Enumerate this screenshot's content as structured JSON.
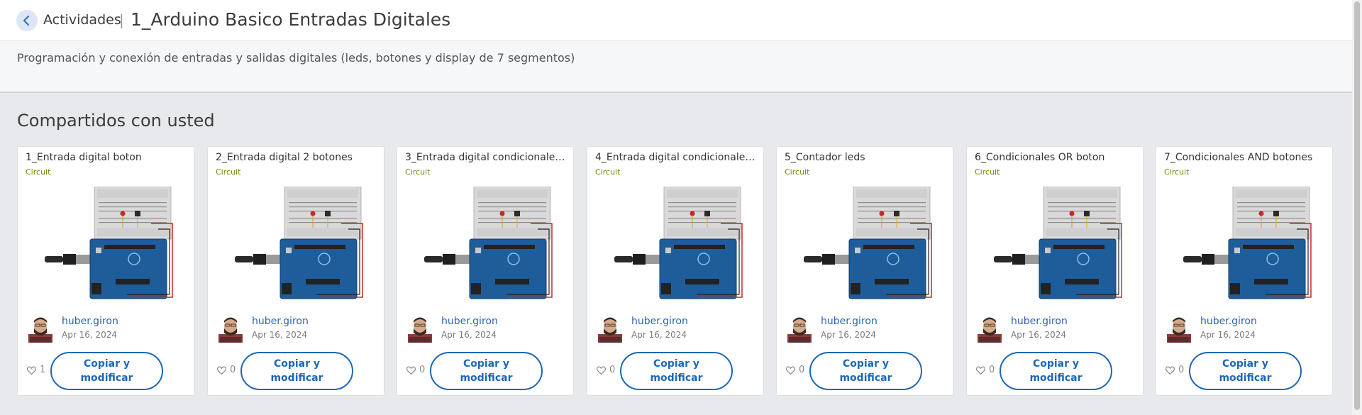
{
  "header": {
    "back_label": "Actividades",
    "separator": "|",
    "title": "1_Arduino Basico Entradas Digitales"
  },
  "description": "Programación y conexión de entradas y salidas digitales (leds, botones y display de 7 segmentos)",
  "section_title": "Compartidos con usted",
  "cards": [
    {
      "title": "1_Entrada digital boton",
      "type": "Circuit",
      "author": "huber.giron",
      "date": "Apr 16, 2024",
      "likes": "1",
      "button": "Copiar y\nmodificar"
    },
    {
      "title": "2_Entrada digital 2 botones",
      "type": "Circuit",
      "author": "huber.giron",
      "date": "Apr 16, 2024",
      "likes": "0",
      "button": "Copiar y\nmodificar"
    },
    {
      "title": "3_Entrada digital condicionales ...",
      "type": "Circuit",
      "author": "huber.giron",
      "date": "Apr 16, 2024",
      "likes": "0",
      "button": "Copiar y\nmodificar"
    },
    {
      "title": "4_Entrada digital condicionales ...",
      "type": "Circuit",
      "author": "huber.giron",
      "date": "Apr 16, 2024",
      "likes": "0",
      "button": "Copiar y\nmodificar"
    },
    {
      "title": "5_Contador leds",
      "type": "Circuit",
      "author": "huber.giron",
      "date": "Apr 16, 2024",
      "likes": "0",
      "button": "Copiar y\nmodificar"
    },
    {
      "title": "6_Condicionales OR boton",
      "type": "Circuit",
      "author": "huber.giron",
      "date": "Apr 16, 2024",
      "likes": "0",
      "button": "Copiar y\nmodificar"
    },
    {
      "title": "7_Condicionales AND botones",
      "type": "Circuit",
      "author": "huber.giron",
      "date": "Apr 16, 2024",
      "likes": "0",
      "button": "Copiar y\nmodificar"
    }
  ],
  "icons": {
    "back": "chevron-left-icon",
    "like": "heart-icon",
    "avatar": "user-avatar",
    "thumbnail": "arduino-circuit-thumbnail"
  },
  "colors": {
    "accent": "#1d67b8",
    "circuit_tag": "#6f8a07",
    "author_link": "#2d63ae"
  }
}
